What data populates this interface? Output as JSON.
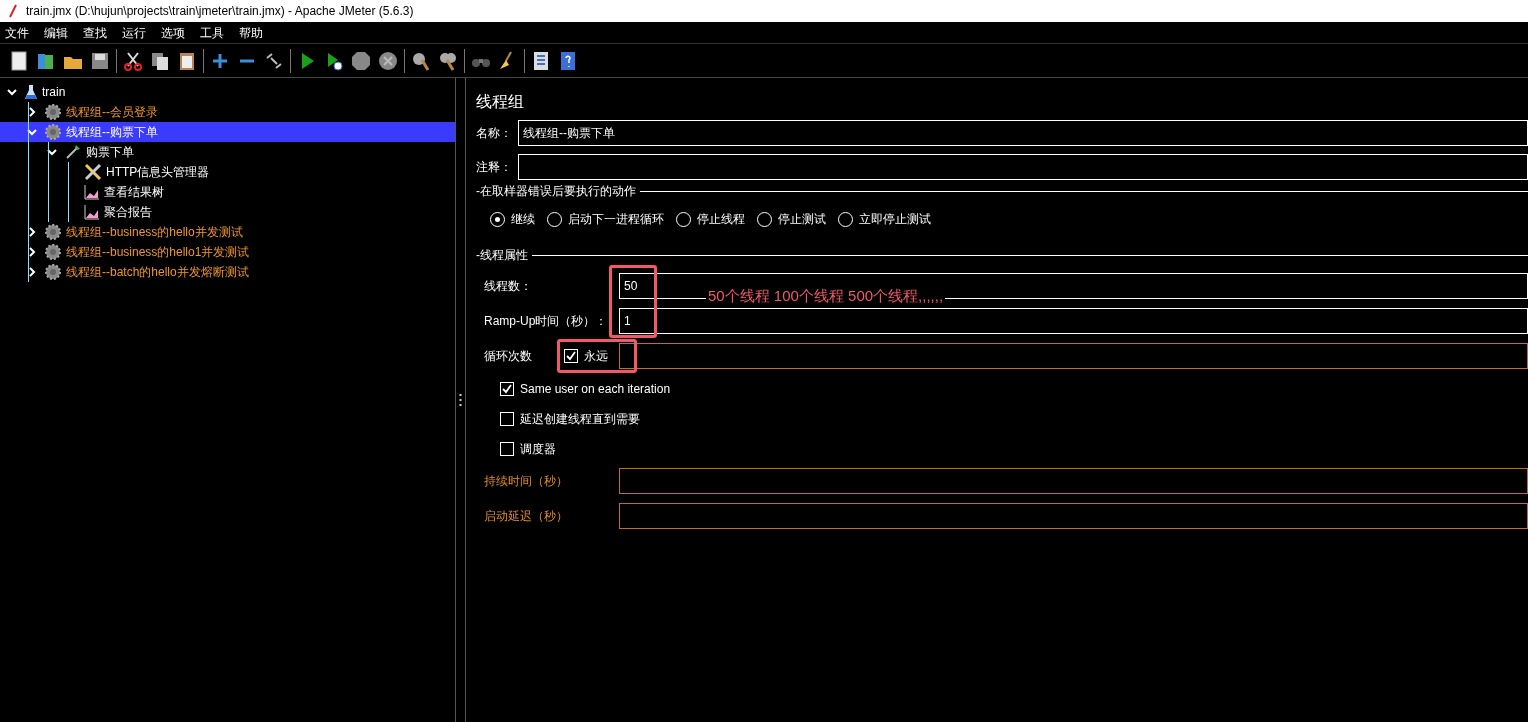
{
  "window": {
    "title": "train.jmx (D:\\hujun\\projects\\train\\jmeter\\train.jmx) - Apache JMeter (5.6.3)"
  },
  "menu": [
    "文件",
    "编辑",
    "查找",
    "运行",
    "选项",
    "工具",
    "帮助"
  ],
  "tree": [
    {
      "label": "train",
      "kind": "plan",
      "expanded": true,
      "selected": false,
      "children": [
        {
          "label": "线程组--会员登录",
          "kind": "group",
          "expanded": false,
          "selected": false
        },
        {
          "label": "线程组--购票下单",
          "kind": "group",
          "expanded": true,
          "selected": true,
          "children": [
            {
              "label": "购票下单",
              "kind": "sampler",
              "expanded": true,
              "selected": false,
              "children": [
                {
                  "label": "HTTP信息头管理器",
                  "kind": "config",
                  "selected": false
                },
                {
                  "label": "查看结果树",
                  "kind": "listener",
                  "selected": false
                },
                {
                  "label": "聚合报告",
                  "kind": "listener",
                  "selected": false
                }
              ]
            }
          ]
        },
        {
          "label": "线程组--business的hello并发测试",
          "kind": "group",
          "expanded": false,
          "selected": false
        },
        {
          "label": "线程组--business的hello1并发测试",
          "kind": "group",
          "expanded": false,
          "selected": false
        },
        {
          "label": "线程组--batch的hello并发熔断测试",
          "kind": "group",
          "expanded": false,
          "selected": false
        }
      ]
    }
  ],
  "panel": {
    "title": "线程组",
    "name_field": {
      "label": "名称：",
      "value": "线程组--购票下单"
    },
    "comment_field": {
      "label": "注释："
    },
    "error_section": {
      "title": "-在取样器错误后要执行的动作",
      "options": [
        {
          "label": "继续",
          "selected": true
        },
        {
          "label": "启动下一进程循环",
          "selected": false
        },
        {
          "label": "停止线程",
          "selected": false
        },
        {
          "label": "停止测试",
          "selected": false
        },
        {
          "label": "立即停止测试",
          "selected": false
        }
      ]
    },
    "thread_section": {
      "title": "-线程属性",
      "threads": {
        "label": "线程数：",
        "value": "50",
        "disabled": false
      },
      "ramp_up": {
        "label": "Ramp-Up时间（秒）：",
        "value": "1",
        "disabled": false
      },
      "loop": {
        "label": "循环次数",
        "checkbox": {
          "label": "永远",
          "checked": true
        },
        "disabled": true
      },
      "checkboxes": [
        {
          "label": "Same user on each iteration",
          "checked": true
        },
        {
          "label": "延迟创建线程直到需要",
          "checked": false
        },
        {
          "label": "调度器",
          "checked": false
        }
      ],
      "duration": {
        "label": "持续时间（秒）",
        "disabled": true
      },
      "delay": {
        "label": "启动延迟（秒）",
        "disabled": true
      }
    },
    "annotation": "50个线程 100个线程  500个线程,,,,,,"
  }
}
